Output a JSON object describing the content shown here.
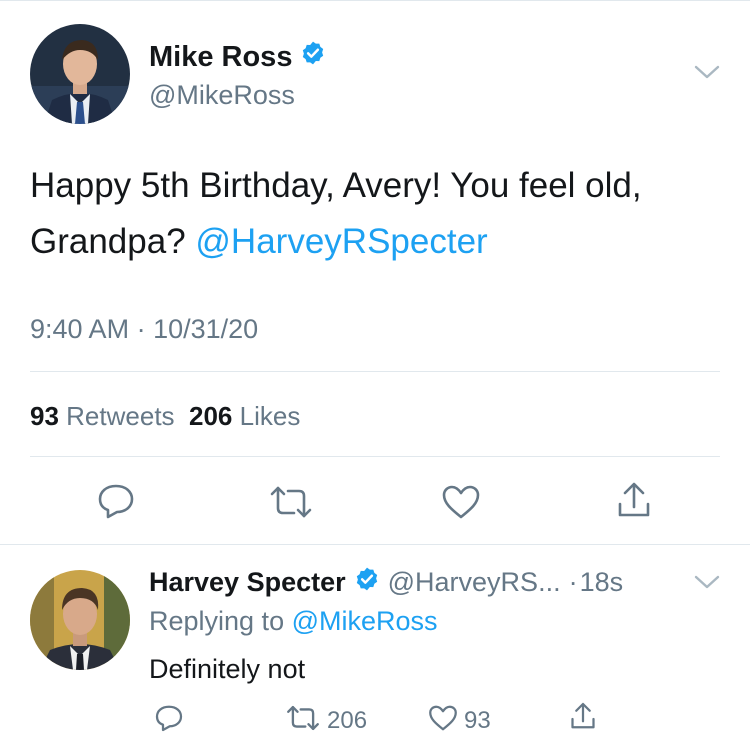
{
  "main_tweet": {
    "author": {
      "display_name": "Mike Ross",
      "handle": "@MikeRoss",
      "verified": true
    },
    "text_prefix": "Happy 5th Birthday, Avery! You feel old, Grandpa? ",
    "text_mention": "@HarveyRSpecter",
    "time": "9:40 AM",
    "separator": "·",
    "date": "10/31/20",
    "retweets_count": "93",
    "retweets_label": "Retweets",
    "likes_count": "206",
    "likes_label": "Likes",
    "icons": [
      "chevron-down-icon",
      "reply-icon",
      "retweet-icon",
      "like-icon",
      "share-icon"
    ]
  },
  "reply_tweet": {
    "author": {
      "display_name": "Harvey Specter",
      "handle": "@HarveyRS...",
      "verified": true
    },
    "time_separator": "·",
    "time_ago": "18s",
    "replying_label": "Replying to",
    "replying_to": "@MikeRoss",
    "text": "Definitely not",
    "retweet_count": "206",
    "like_count": "93"
  },
  "colors": {
    "accent": "#1da1f2",
    "text": "#14171a",
    "secondary": "#657786",
    "divider": "#e1e8ed"
  }
}
